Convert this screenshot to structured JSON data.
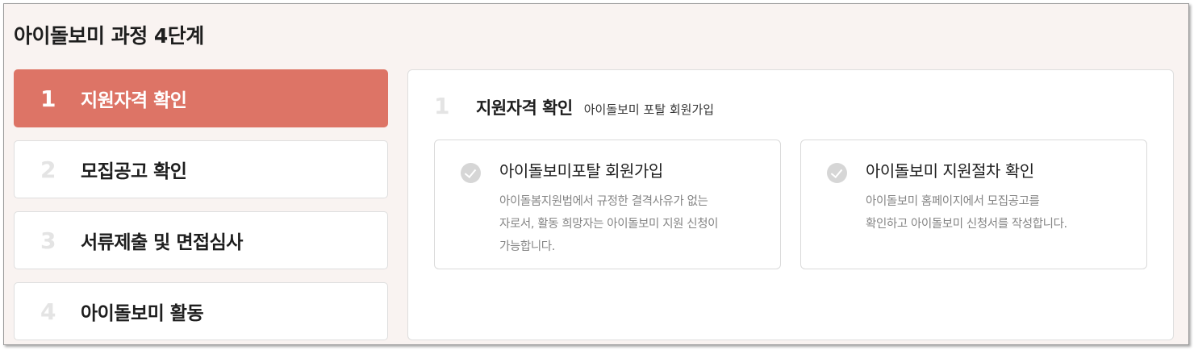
{
  "page": {
    "title": "아이돌보미 과정 4단계"
  },
  "steps": [
    {
      "number": "1",
      "label": "지원자격 확인",
      "active": true
    },
    {
      "number": "2",
      "label": "모집공고 확인",
      "active": false
    },
    {
      "number": "3",
      "label": "서류제출 및 면접심사",
      "active": false
    },
    {
      "number": "4",
      "label": "아이돌보미 활동",
      "active": false
    }
  ],
  "detail": {
    "number": "1",
    "title": "지원자격 확인",
    "subtitle": "아이돌보미 포탈 회원가입",
    "cards": [
      {
        "icon": "check-circle-icon",
        "title": "아이돌보미포탈 회원가입",
        "desc_lines": [
          "아이돌봄지원법에서 규정한 결격사유가 없는",
          "자로서, 활동 희망자는 아이돌보미 지원 신청이",
          "가능합니다."
        ]
      },
      {
        "icon": "check-circle-icon",
        "title": "아이돌보미 지원절차 확인",
        "desc_lines": [
          "아이돌보미 홈페이지에서 모집공고를",
          "확인하고 아이돌보미 신청서를 작성합니다."
        ]
      }
    ]
  },
  "colors": {
    "accent": "#dd7466",
    "background": "#f9f3f1",
    "muted_number": "#e4e4e4",
    "icon_gray": "#d6d6d6",
    "desc_text": "#858585"
  }
}
